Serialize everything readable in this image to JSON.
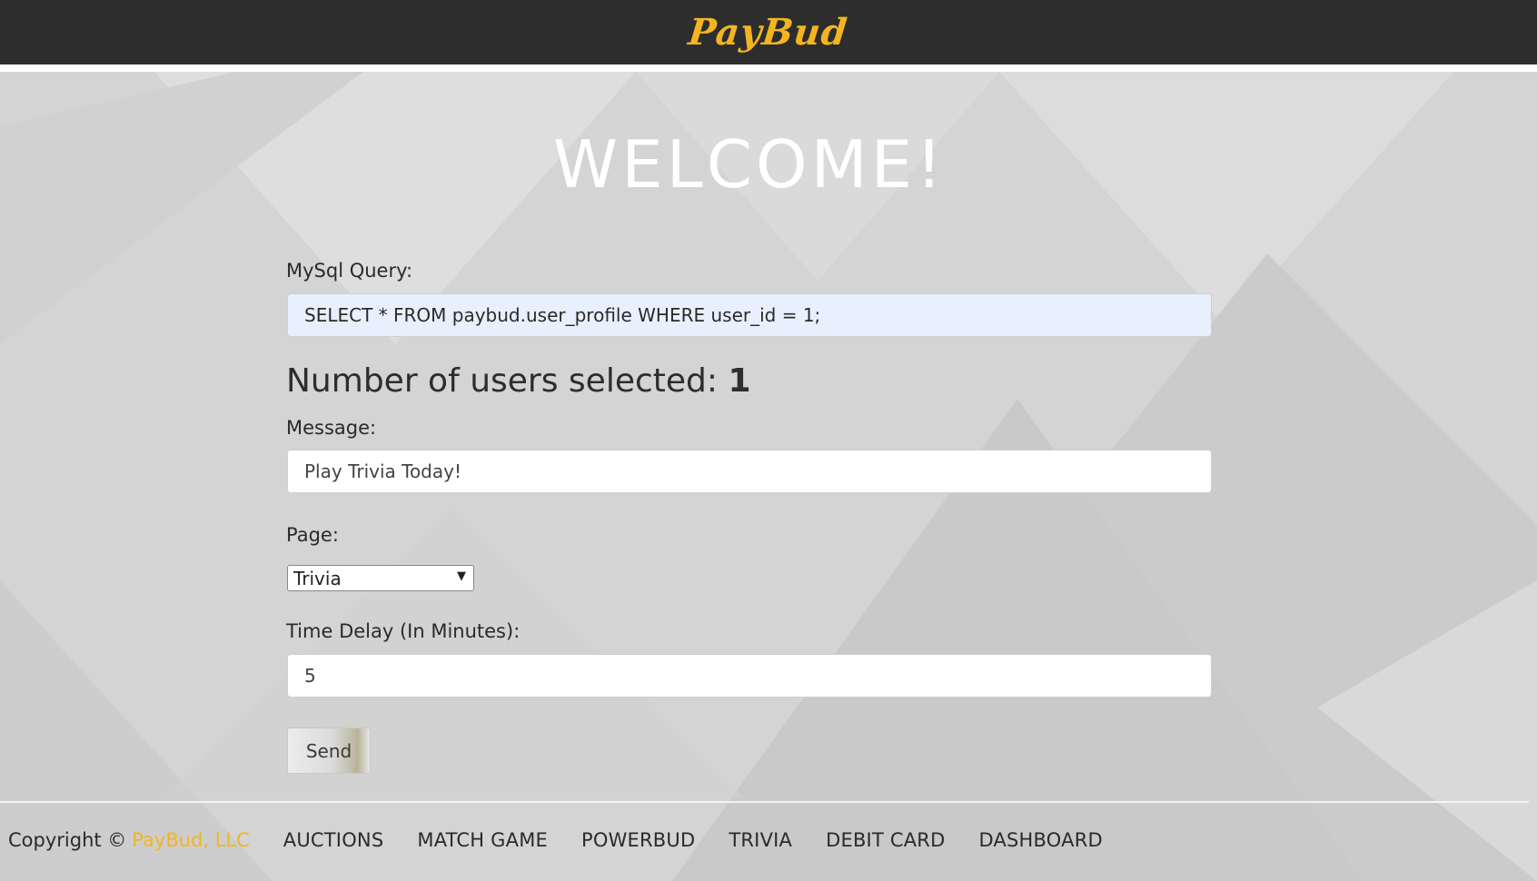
{
  "header": {
    "logo_text": "PayBud",
    "logo_color": "#f2b521",
    "background_color": "#2d2d2d"
  },
  "main": {
    "title": "WELCOME!",
    "query": {
      "label": "MySql Query:",
      "value": "SELECT * FROM paybud.user_profile WHERE user_id = 1;"
    },
    "users_selected": {
      "label": "Number of users selected:",
      "count": "1"
    },
    "message": {
      "label": "Message:",
      "value": "Play Trivia Today!"
    },
    "page": {
      "label": "Page:",
      "selected": "Trivia"
    },
    "delay": {
      "label": "Time Delay (In Minutes):",
      "value": "5"
    },
    "send_label": "Send"
  },
  "footer": {
    "copyright": "Copyright ©",
    "company": "PayBud, LLC",
    "nav": [
      "AUCTIONS",
      "MATCH GAME",
      "POWERBUD",
      "TRIVIA",
      "DEBIT CARD",
      "DASHBOARD"
    ]
  }
}
